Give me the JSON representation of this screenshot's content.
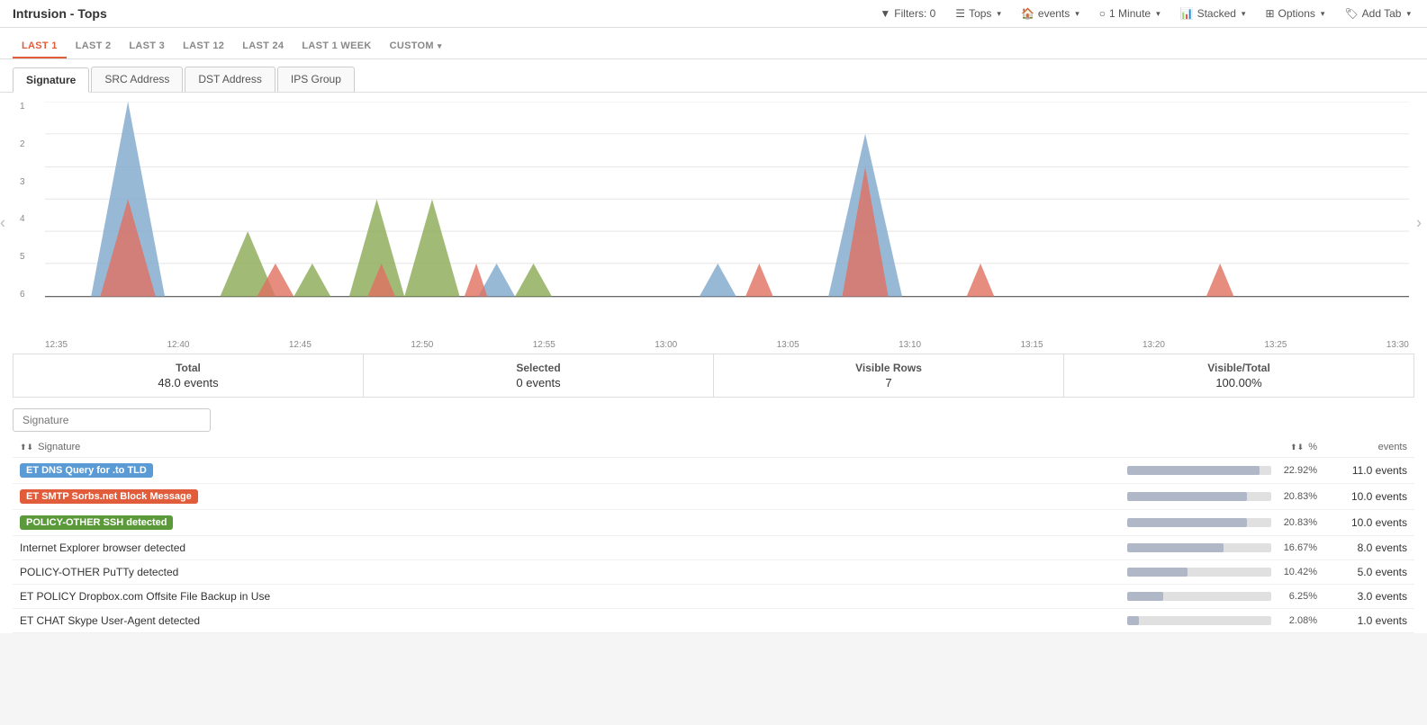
{
  "topbar": {
    "title": "Intrusion - Tops",
    "controls": [
      {
        "icon": "filter-icon",
        "label": "Filters: 0"
      },
      {
        "icon": "tops-icon",
        "label": "Tops",
        "hasDropdown": true
      },
      {
        "icon": "events-icon",
        "label": "events",
        "hasDropdown": true
      },
      {
        "icon": "clock-icon",
        "label": "1 Minute",
        "hasDropdown": true
      },
      {
        "icon": "chart-icon",
        "label": "Stacked",
        "hasDropdown": true
      },
      {
        "icon": "grid-icon",
        "label": "Options",
        "hasDropdown": true
      },
      {
        "icon": "tag-icon",
        "label": "Add Tab",
        "hasDropdown": true
      }
    ]
  },
  "timerange": {
    "tabs": [
      {
        "label": "LAST 1",
        "active": true
      },
      {
        "label": "LAST 2",
        "active": false
      },
      {
        "label": "LAST 3",
        "active": false
      },
      {
        "label": "LAST 12",
        "active": false
      },
      {
        "label": "LAST 24",
        "active": false
      },
      {
        "label": "LAST 1 WEEK",
        "active": false
      },
      {
        "label": "CUSTOM",
        "active": false,
        "hasDropdown": true
      }
    ]
  },
  "subtabs": [
    {
      "label": "Signature",
      "active": true
    },
    {
      "label": "SRC Address",
      "active": false
    },
    {
      "label": "DST Address",
      "active": false
    },
    {
      "label": "IPS Group",
      "active": false
    }
  ],
  "chart": {
    "yLabels": [
      "1",
      "2",
      "3",
      "4",
      "5",
      "6"
    ],
    "xLabels": [
      "12:35",
      "12:40",
      "12:45",
      "12:50",
      "12:55",
      "13:00",
      "13:05",
      "13:10",
      "13:15",
      "13:20",
      "13:25",
      "13:30"
    ],
    "series": {
      "blue": "#7ea7cc",
      "red": "#e07060",
      "green": "#8aaa55"
    }
  },
  "stats": {
    "total_label": "Total",
    "total_value": "48.0 events",
    "selected_label": "Selected",
    "selected_value": "0 events",
    "visible_label": "Visible Rows",
    "visible_value": "7",
    "ratio_label": "Visible/Total",
    "ratio_value": "100.00%"
  },
  "filter": {
    "placeholder": "Signature"
  },
  "table": {
    "headers": [
      {
        "label": "Signature",
        "sortable": true
      },
      {
        "label": "%",
        "sortable": true
      },
      {
        "label": "events"
      }
    ],
    "rows": [
      {
        "label": "ET DNS Query for .to TLD",
        "badge": "blue",
        "pct": 22.92,
        "pct_label": "22.92%",
        "events": "11.0 events"
      },
      {
        "label": "ET SMTP Sorbs.net Block Message",
        "badge": "red",
        "pct": 20.83,
        "pct_label": "20.83%",
        "events": "10.0 events"
      },
      {
        "label": "POLICY-OTHER SSH detected",
        "badge": "green",
        "pct": 20.83,
        "pct_label": "20.83%",
        "events": "10.0 events"
      },
      {
        "label": "Internet Explorer browser detected",
        "badge": null,
        "pct": 16.67,
        "pct_label": "16.67%",
        "events": "8.0 events"
      },
      {
        "label": "POLICY-OTHER PuTTy detected",
        "badge": null,
        "pct": 10.42,
        "pct_label": "10.42%",
        "events": "5.0 events"
      },
      {
        "label": "ET POLICY Dropbox.com Offsite File Backup in Use",
        "badge": null,
        "pct": 6.25,
        "pct_label": "6.25%",
        "events": "3.0 events"
      },
      {
        "label": "ET CHAT Skype User-Agent detected",
        "badge": null,
        "pct": 2.08,
        "pct_label": "2.08%",
        "events": "1.0 events"
      }
    ]
  }
}
